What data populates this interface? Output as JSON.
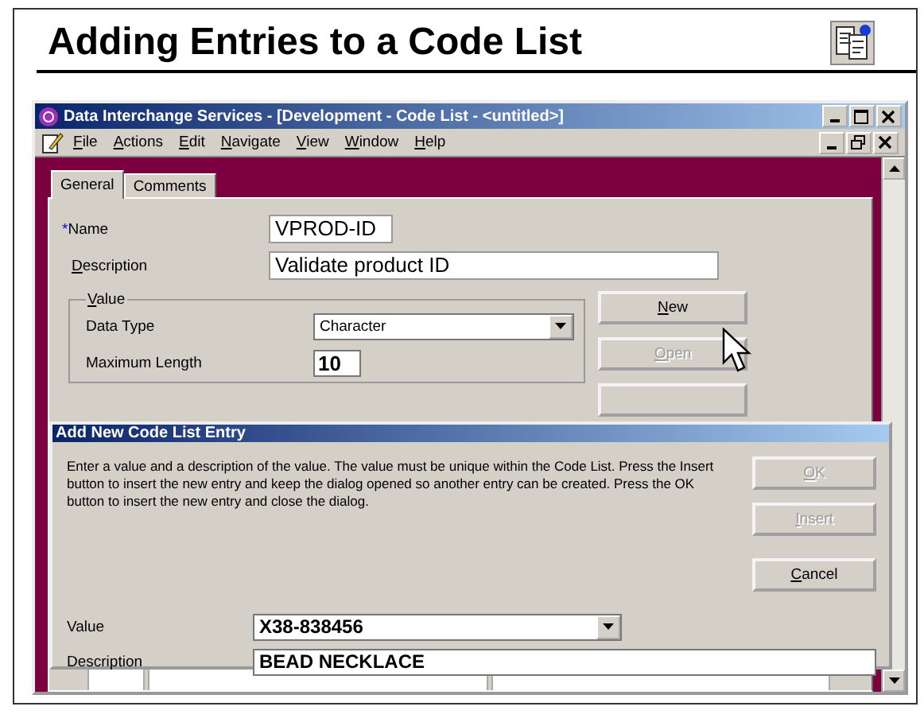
{
  "slide": {
    "title": "Adding Entries to a Code List"
  },
  "window": {
    "title": "Data Interchange Services - [Development - Code List - <untitled>]"
  },
  "menu": [
    {
      "label": "File",
      "mnemonic": true
    },
    {
      "label": "Actions",
      "mnemonic": true
    },
    {
      "label": "Edit",
      "mnemonic": true
    },
    {
      "label": "Navigate",
      "mnemonic": true
    },
    {
      "label": "View",
      "mnemonic": true
    },
    {
      "label": "Window",
      "mnemonic": true
    },
    {
      "label": "Help",
      "mnemonic": true
    }
  ],
  "tabs": [
    {
      "label": "General",
      "selected": true
    },
    {
      "label": "Comments",
      "selected": false
    }
  ],
  "form": {
    "name": {
      "label": "Name",
      "required_mark": "*",
      "value": "VPROD-ID"
    },
    "description": {
      "label": "Description",
      "mnemonic": true,
      "value": "Validate product ID"
    },
    "value_group": {
      "label": "Value",
      "mnemonic": true,
      "data_type": {
        "label": "Data Type",
        "value": "Character"
      },
      "maximum_length": {
        "label": "Maximum Length",
        "value": "10"
      }
    }
  },
  "side_buttons": [
    {
      "label": "New",
      "mnemonic": true,
      "disabled": false
    },
    {
      "label": "Open",
      "mnemonic": true,
      "disabled": true
    }
  ],
  "dialog": {
    "title": "Add New Code List Entry",
    "instructions": "Enter a value and a description of the value.  The value must be unique within the Code List.  Press the Insert button to insert the new entry and keep the dialog opened so another entry can be created.  Press the OK button to insert the new entry and close the dialog.",
    "buttons": [
      {
        "label": "OK",
        "mnemonic": true,
        "disabled": true
      },
      {
        "label": "Insert",
        "mnemonic": true,
        "disabled": true
      },
      {
        "label": "Cancel",
        "mnemonic": true,
        "disabled": false
      }
    ],
    "value": {
      "label": "Value",
      "value": "X38-838456"
    },
    "description": {
      "label": "Description",
      "value": "BEAD NECKLACE"
    }
  }
}
